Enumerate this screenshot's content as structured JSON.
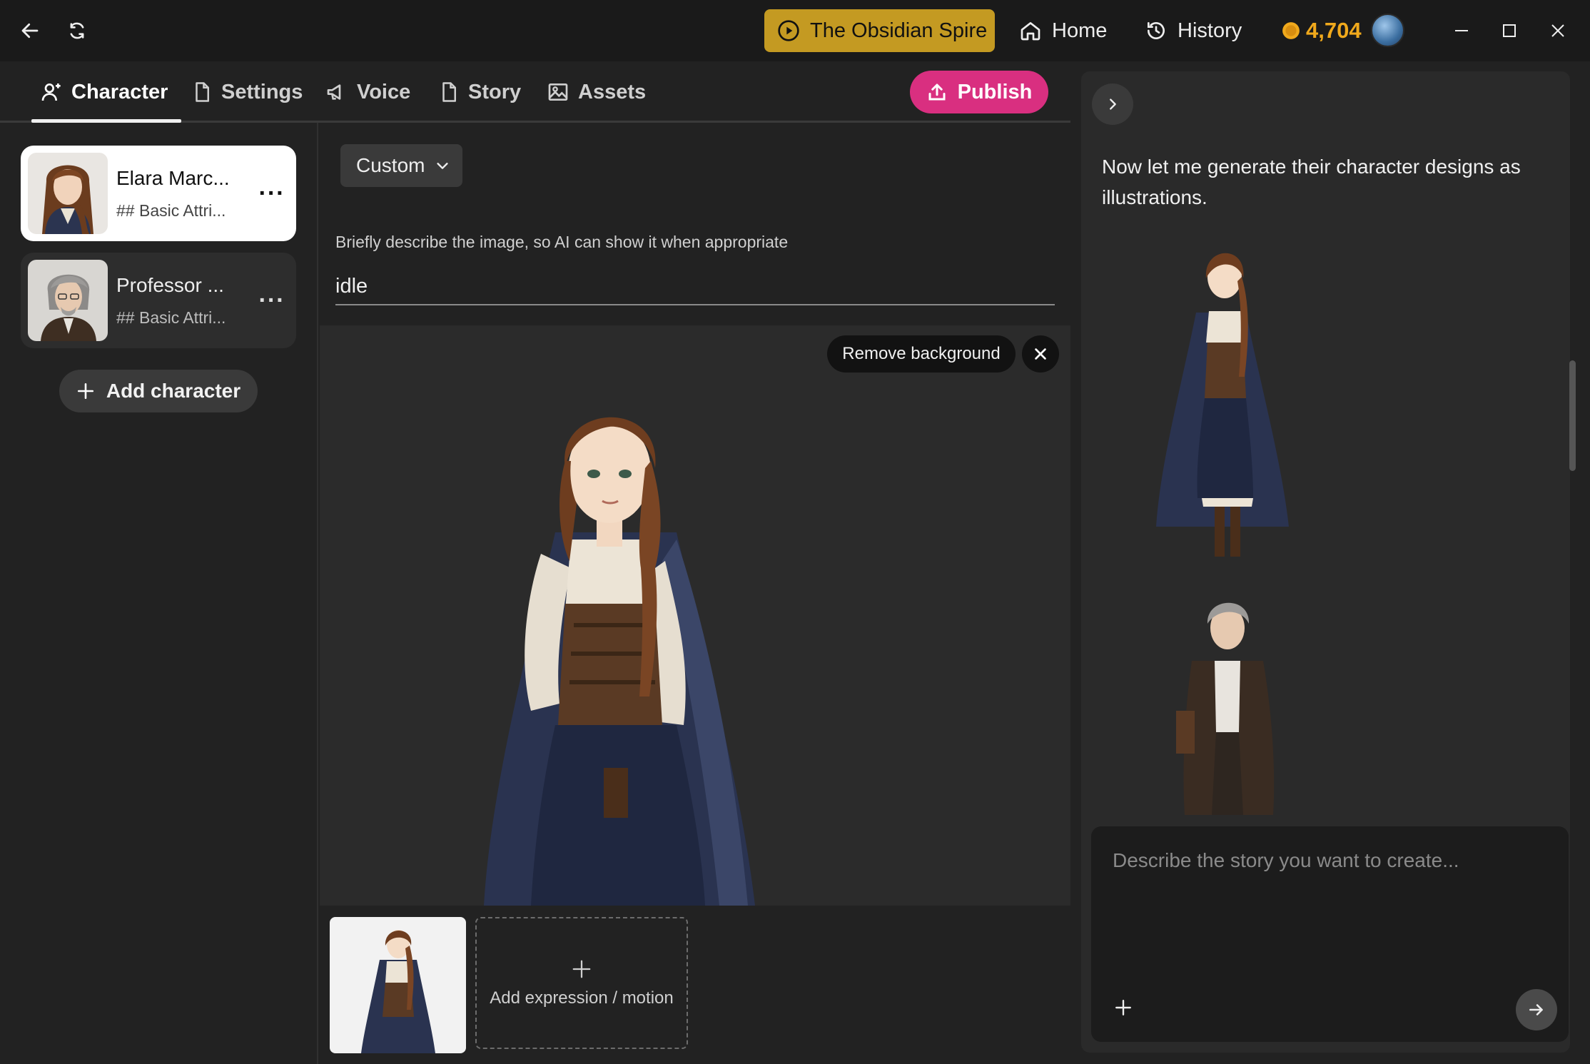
{
  "topbar": {
    "story_title": "The Obsidian Spire",
    "nav": [
      {
        "label": "Home",
        "icon": "home-icon"
      },
      {
        "label": "History",
        "icon": "history-icon"
      }
    ],
    "coins": "4,704"
  },
  "tabs": [
    {
      "label": "Character",
      "icon": "character-icon",
      "active": true
    },
    {
      "label": "Settings",
      "icon": "document-icon"
    },
    {
      "label": "Voice",
      "icon": "megaphone-icon"
    },
    {
      "label": "Story",
      "icon": "document-icon"
    },
    {
      "label": "Assets",
      "icon": "image-icon"
    }
  ],
  "publish_label": "Publish",
  "characters": [
    {
      "name": "Elara Marc...",
      "subtitle": "## Basic Attri...",
      "selected": true
    },
    {
      "name": "Professor ...",
      "subtitle": "## Basic Attri...",
      "selected": false
    }
  ],
  "add_character_label": "Add character",
  "editor": {
    "dropdown_value": "Custom",
    "description_label": "Briefly describe the image, so AI can show it when appropriate",
    "description_value": "idle",
    "remove_background_label": "Remove background",
    "add_expression_label": "Add expression / motion"
  },
  "chat": {
    "message": "Now let me generate their character designs as illustrations.",
    "composer_placeholder": "Describe the story you want to create..."
  },
  "colors": {
    "accent_gold": "#c49a22",
    "publish_pink": "#d92f80",
    "coin_orange": "#f0a91c"
  }
}
